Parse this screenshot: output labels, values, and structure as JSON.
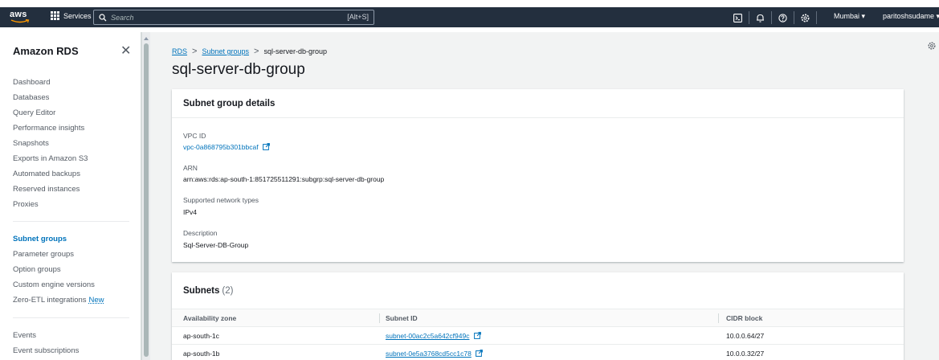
{
  "topbar": {
    "logo_text": "aws",
    "services_label": "Services",
    "search_placeholder": "Search",
    "search_shortcut": "[Alt+S]",
    "region_label": "Mumbai ▾",
    "user_label": "paritoshsudame ▾"
  },
  "sidebar": {
    "title": "Amazon RDS",
    "close_glyph": "✕",
    "group1": [
      {
        "label": "Dashboard"
      },
      {
        "label": "Databases"
      },
      {
        "label": "Query Editor"
      },
      {
        "label": "Performance insights"
      },
      {
        "label": "Snapshots"
      },
      {
        "label": "Exports in Amazon S3"
      },
      {
        "label": "Automated backups"
      },
      {
        "label": "Reserved instances"
      },
      {
        "label": "Proxies"
      }
    ],
    "group2": [
      {
        "label": "Subnet groups",
        "active": true
      },
      {
        "label": "Parameter groups"
      },
      {
        "label": "Option groups"
      },
      {
        "label": "Custom engine versions"
      },
      {
        "label": "Zero-ETL integrations",
        "badge": "New"
      }
    ],
    "group3": [
      {
        "label": "Events"
      },
      {
        "label": "Event subscriptions"
      }
    ]
  },
  "breadcrumb": {
    "items": [
      "RDS",
      "Subnet groups",
      "sql-server-db-group"
    ],
    "separator": ">"
  },
  "page": {
    "title": "sql-server-db-group"
  },
  "details": {
    "header": "Subnet group details",
    "vpc_label": "VPC ID",
    "vpc_value": "vpc-0a868795b301bbcaf",
    "arn_label": "ARN",
    "arn_value": "arn:aws:rds:ap-south-1:851725511291:subgrp:sql-server-db-group",
    "network_label": "Supported network types",
    "network_value": "IPv4",
    "description_label": "Description",
    "description_value": "Sql-Server-DB-Group"
  },
  "subnets": {
    "header": "Subnets",
    "count": "(2)",
    "columns": [
      "Availability zone",
      "Subnet ID",
      "CIDR block"
    ],
    "rows": [
      {
        "az": "ap-south-1c",
        "subnet_id": "subnet-00ac2c5a642cf949c",
        "cidr": "10.0.0.64/27"
      },
      {
        "az": "ap-south-1b",
        "subnet_id": "subnet-0e5a3768cd5cc1c78",
        "cidr": "10.0.0.32/27"
      }
    ]
  },
  "colors": {
    "topbar": "#232f3e",
    "link": "#0073bb",
    "background": "#f2f3f3"
  },
  "icons": [
    "grid-icon",
    "search-icon",
    "cloudshell-icon",
    "bell-icon",
    "help-icon",
    "gear-icon",
    "external-link-icon",
    "close-icon"
  ]
}
